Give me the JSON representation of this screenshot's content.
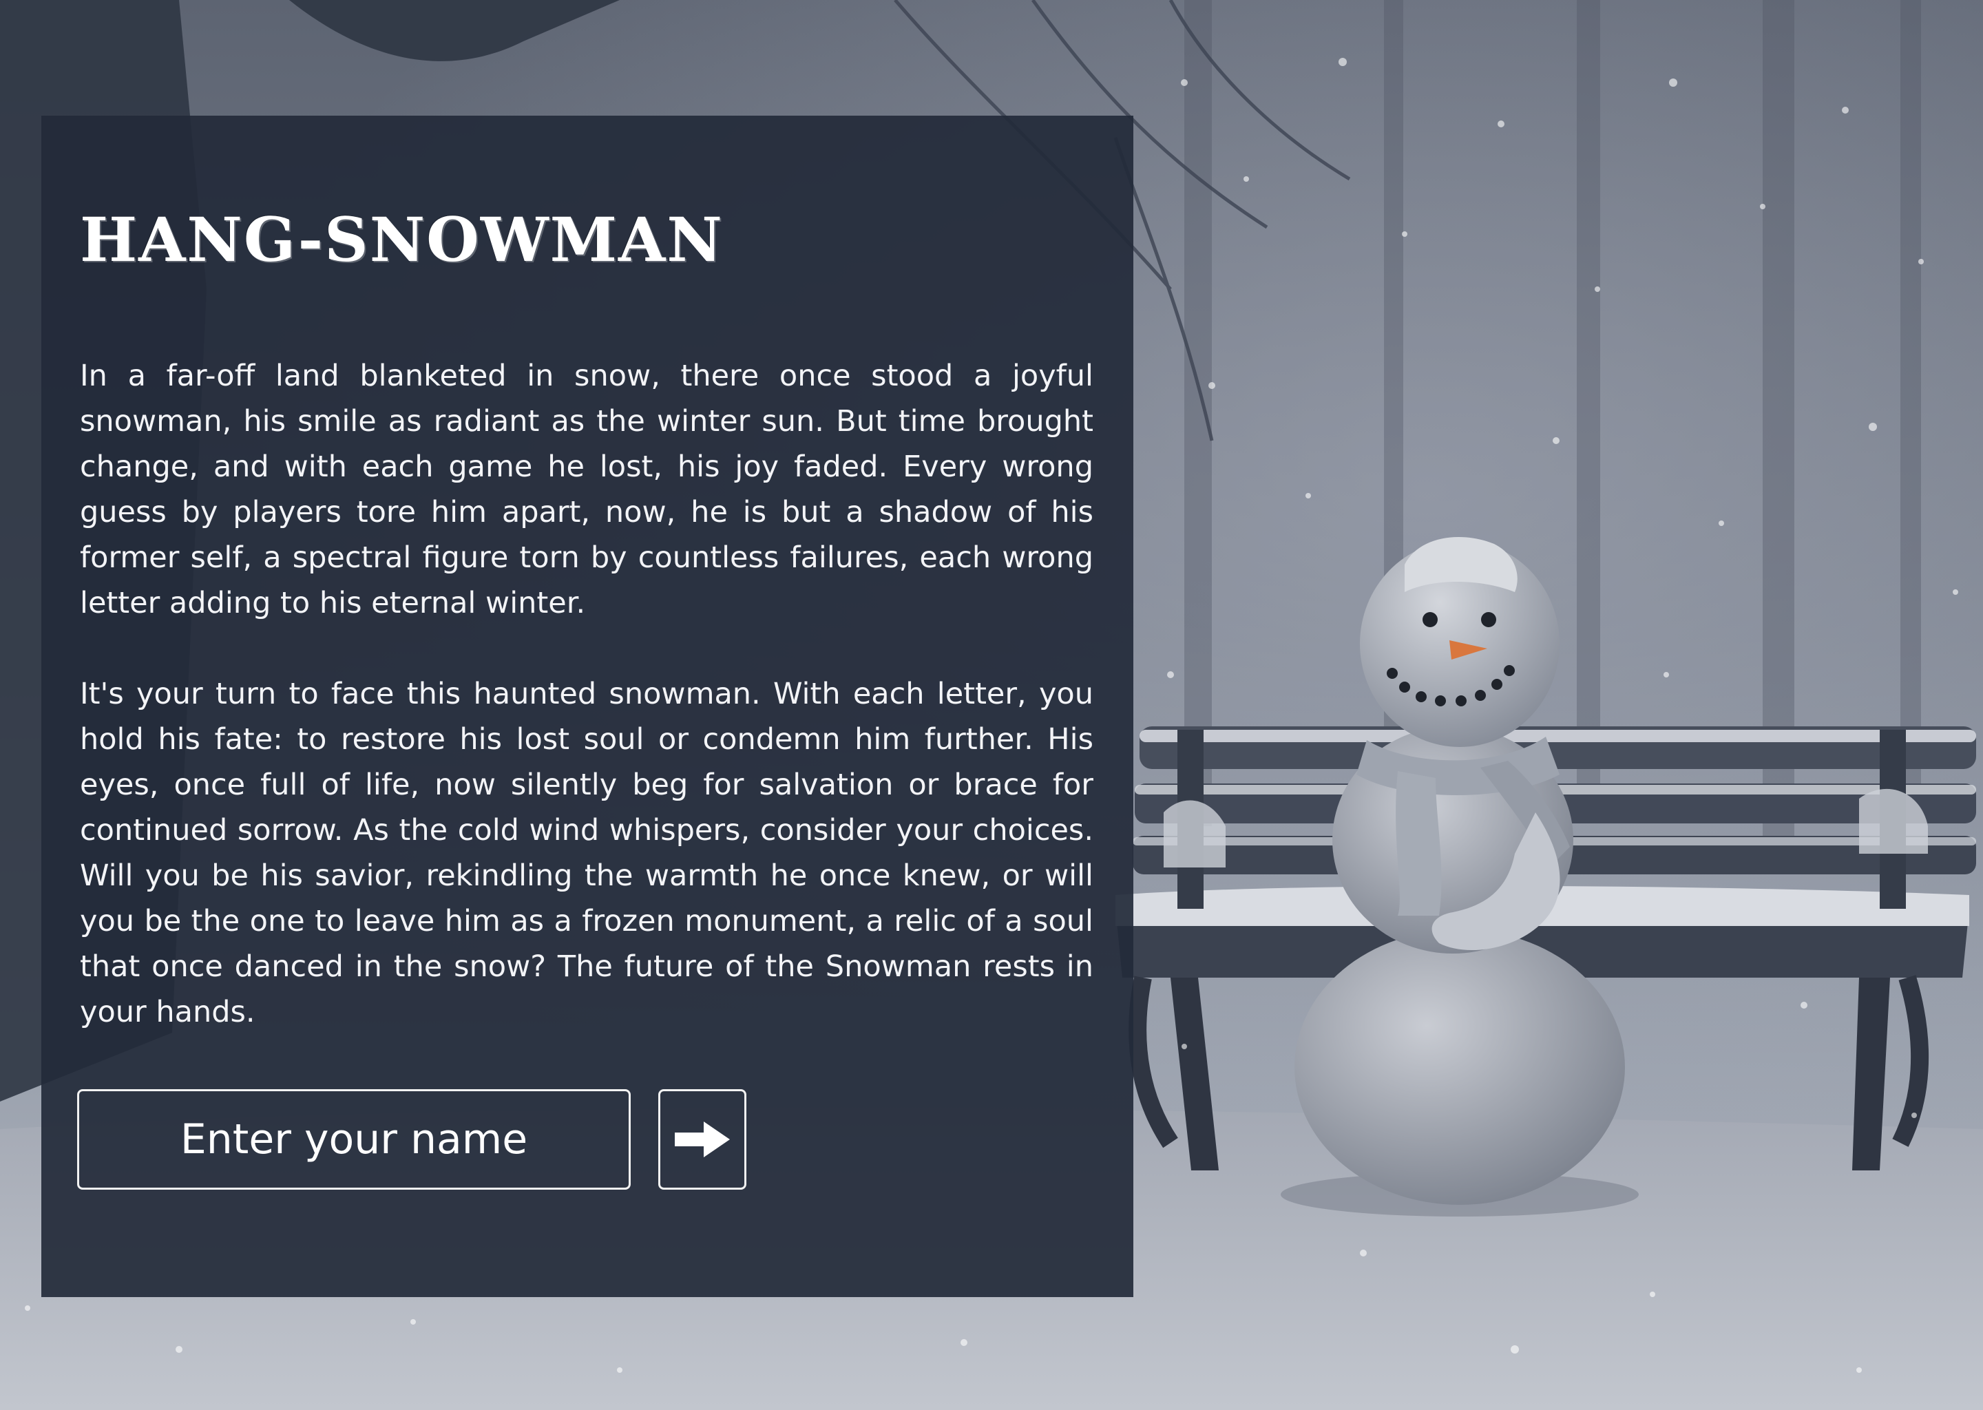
{
  "app": {
    "title": "HANG-SNOWMAN"
  },
  "story": {
    "paragraphs": [
      "In a far-off land blanketed in snow, there once stood a joyful snowman, his smile as radiant as the winter sun. But time brought change, and with each game he lost, his joy faded. Every wrong guess by players tore him apart, now, he is but a shadow of his former self, a spectral figure torn by countless failures, each wrong letter adding to his eternal winter.",
      "It's your turn to face this haunted snowman. With each letter, you hold his fate: to restore his lost soul or condemn him further. His eyes, once full of life, now silently beg for salvation or brace for continued sorrow. As the cold wind whispers, consider your choices. Will you be his savior, rekindling the warmth he once knew, or will you be the one to leave him as a frozen monument, a relic of a soul that once danced in the snow? The future of the Snowman rests in your hands."
    ]
  },
  "name_form": {
    "placeholder": "Enter your name",
    "value": "",
    "submit_icon": "arrow-right-icon"
  },
  "colors": {
    "panel_background": "#232a3a",
    "text": "#ffffff",
    "snow_background": "#9aa1ad",
    "carrot": "#d9773e"
  }
}
